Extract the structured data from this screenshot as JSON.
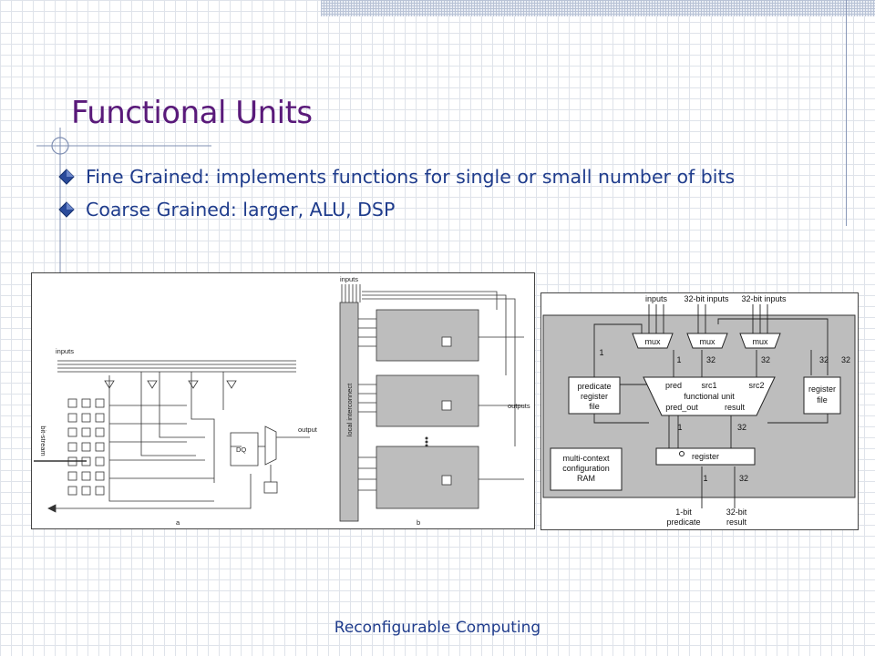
{
  "slide": {
    "title": "Functional Units",
    "bullets": [
      {
        "text": "Fine Grained: implements functions for single or small number of bits"
      },
      {
        "text": "Coarse Grained: larger, ALU, DSP"
      }
    ],
    "footer": "Reconfigurable Computing"
  },
  "figure_fine": {
    "labels": {
      "inputs_a": "inputs",
      "bitstream": "bit-stream",
      "dq": "DQ",
      "output": "output",
      "panel_a": "a",
      "inputs_b": "inputs",
      "local_interconnect": "local interconnect",
      "outputs": "outputs",
      "panel_b": "b"
    }
  },
  "figure_coarse": {
    "labels": {
      "inputs": "inputs",
      "inputs32_1": "32-bit inputs",
      "inputs32_2": "32-bit inputs",
      "mux": "mux",
      "one": "1",
      "thirtytwo": "32",
      "pred": "pred",
      "src1": "src1",
      "src2": "src2",
      "functional_unit": "functional unit",
      "pred_out": "pred_out",
      "result": "result",
      "predicate_register_file": [
        "predicate",
        "register",
        "file"
      ],
      "register_file": [
        "register",
        "file"
      ],
      "register": "register",
      "multi_context": [
        "multi-context",
        "configuration",
        "RAM"
      ],
      "one_bit_predicate": [
        "1-bit",
        "predicate"
      ],
      "thirtytwo_bit_result": [
        "32-bit",
        "result"
      ]
    }
  },
  "colors": {
    "title": "#5a1a7a",
    "text": "#1f3c8c",
    "bullet": "#2a4a9a",
    "gray_panel": "#bdbdbd"
  }
}
